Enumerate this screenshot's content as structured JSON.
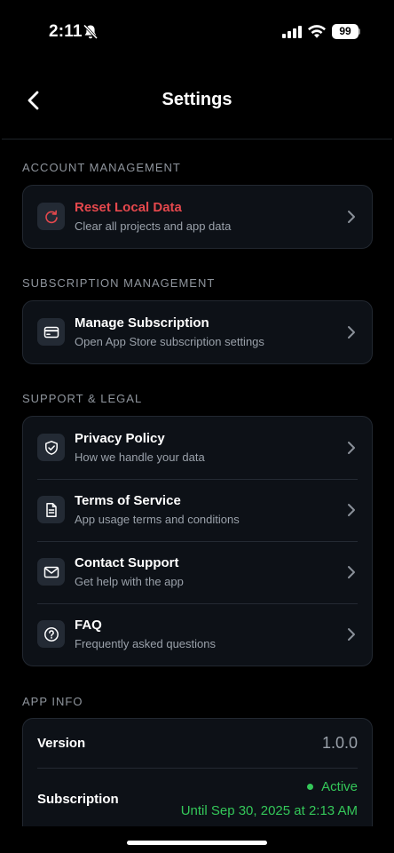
{
  "status_bar": {
    "time": "2:11",
    "battery": "99"
  },
  "nav": {
    "title": "Settings"
  },
  "sections": {
    "account": {
      "header": "ACCOUNT MANAGEMENT",
      "items": [
        {
          "title": "Reset Local Data",
          "subtitle": "Clear all projects and app data",
          "icon": "reset-icon"
        }
      ]
    },
    "subscription": {
      "header": "SUBSCRIPTION MANAGEMENT",
      "items": [
        {
          "title": "Manage Subscription",
          "subtitle": "Open App Store subscription settings",
          "icon": "credit-card-icon"
        }
      ]
    },
    "support": {
      "header": "SUPPORT & LEGAL",
      "items": [
        {
          "title": "Privacy Policy",
          "subtitle": "How we handle your data",
          "icon": "shield-check-icon"
        },
        {
          "title": "Terms of Service",
          "subtitle": "App usage terms and conditions",
          "icon": "document-icon"
        },
        {
          "title": "Contact Support",
          "subtitle": "Get help with the app",
          "icon": "mail-icon"
        },
        {
          "title": "FAQ",
          "subtitle": "Frequently asked questions",
          "icon": "question-circle-icon"
        }
      ]
    },
    "app_info": {
      "header": "APP INFO",
      "version_label": "Version",
      "version_value": "1.0.0",
      "subscription_label": "Subscription",
      "subscription_status": "Active",
      "subscription_until": "Until Sep 30, 2025 at 2:13 AM"
    }
  },
  "colors": {
    "danger": "#e5484d",
    "success": "#34c759",
    "card_bg": "#0d1117",
    "icon_bg": "#232a34",
    "secondary_text": "#9aa1aa"
  }
}
